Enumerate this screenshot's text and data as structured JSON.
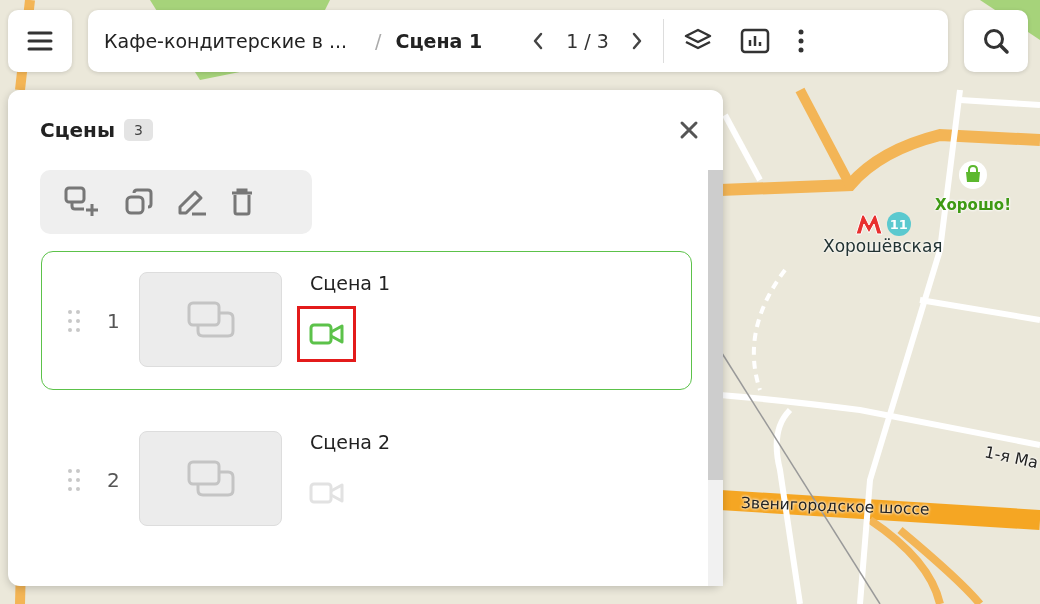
{
  "topbar": {
    "breadcrumb": "Кафе-кондитерские в ...",
    "separator": "/",
    "current_scene": "Сцена 1",
    "pager": "1 / 3"
  },
  "panel": {
    "title": "Сцены",
    "count": "3"
  },
  "scenes": [
    {
      "number": "1",
      "title": "Сцена 1",
      "selected": true,
      "video": true,
      "highlighted": true
    },
    {
      "number": "2",
      "title": "Сцена 2",
      "selected": false,
      "video": false,
      "highlighted": false
    }
  ],
  "map": {
    "labels": [
      {
        "kind": "poi",
        "text": "Хорошо!"
      },
      {
        "kind": "metro",
        "text": "Хорошёвская",
        "line": "11",
        "color": "#5bc9cf"
      },
      {
        "kind": "street",
        "text": "1-я Ма"
      },
      {
        "kind": "street",
        "text": "Звенигородское шоссе"
      }
    ]
  }
}
